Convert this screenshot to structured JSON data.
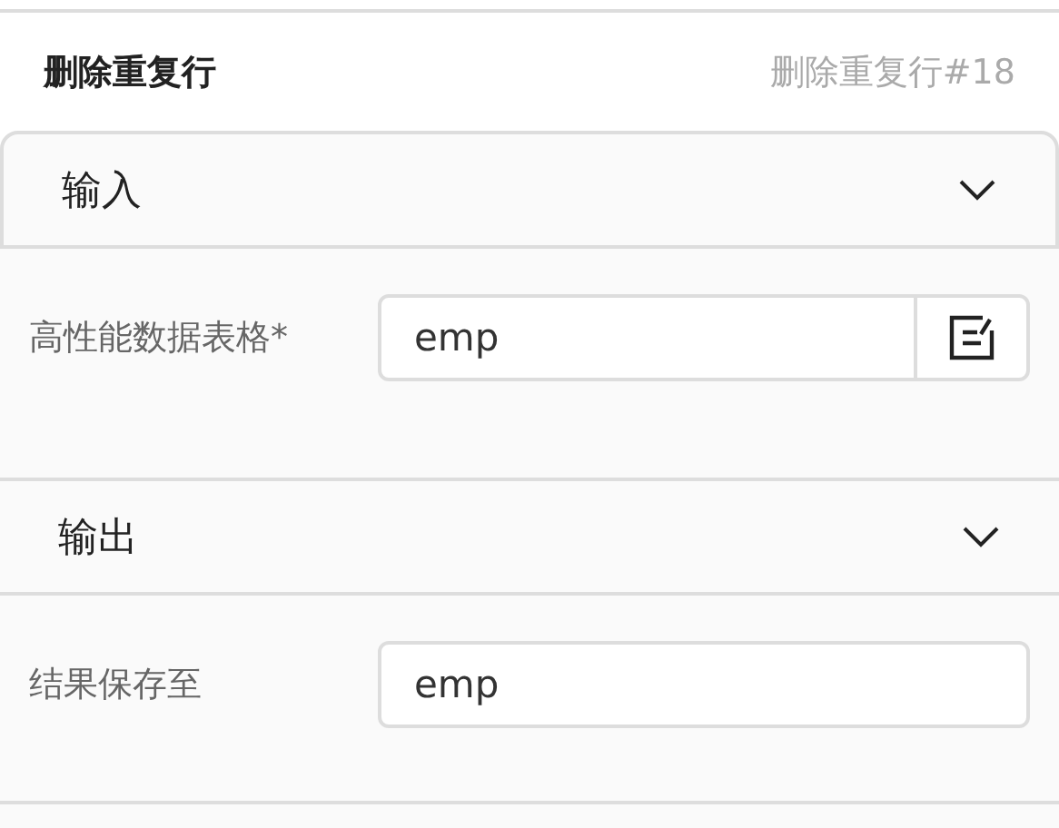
{
  "header": {
    "title": "删除重复行",
    "instance": "删除重复行#18"
  },
  "sections": [
    {
      "title": "输入",
      "expanded": true,
      "fields": [
        {
          "label": "高性能数据表格*",
          "value": "emp",
          "kind": "picker"
        }
      ]
    },
    {
      "title": "输出",
      "expanded": true,
      "fields": [
        {
          "label": "结果保存至",
          "value": "emp",
          "kind": "text"
        }
      ]
    }
  ]
}
